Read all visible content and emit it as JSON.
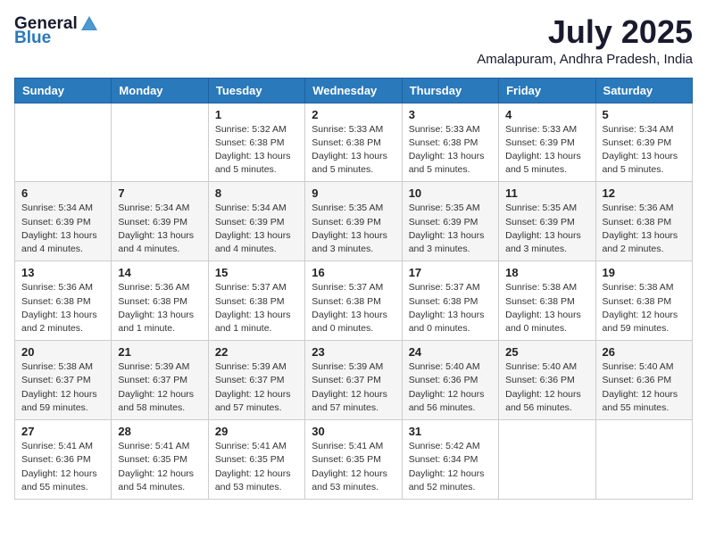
{
  "header": {
    "logo_general": "General",
    "logo_blue": "Blue",
    "month": "July 2025",
    "location": "Amalapuram, Andhra Pradesh, India"
  },
  "days_of_week": [
    "Sunday",
    "Monday",
    "Tuesday",
    "Wednesday",
    "Thursday",
    "Friday",
    "Saturday"
  ],
  "weeks": [
    [
      {
        "day": "",
        "info": ""
      },
      {
        "day": "",
        "info": ""
      },
      {
        "day": "1",
        "info": "Sunrise: 5:32 AM\nSunset: 6:38 PM\nDaylight: 13 hours and 5 minutes."
      },
      {
        "day": "2",
        "info": "Sunrise: 5:33 AM\nSunset: 6:38 PM\nDaylight: 13 hours and 5 minutes."
      },
      {
        "day": "3",
        "info": "Sunrise: 5:33 AM\nSunset: 6:38 PM\nDaylight: 13 hours and 5 minutes."
      },
      {
        "day": "4",
        "info": "Sunrise: 5:33 AM\nSunset: 6:39 PM\nDaylight: 13 hours and 5 minutes."
      },
      {
        "day": "5",
        "info": "Sunrise: 5:34 AM\nSunset: 6:39 PM\nDaylight: 13 hours and 5 minutes."
      }
    ],
    [
      {
        "day": "6",
        "info": "Sunrise: 5:34 AM\nSunset: 6:39 PM\nDaylight: 13 hours and 4 minutes."
      },
      {
        "day": "7",
        "info": "Sunrise: 5:34 AM\nSunset: 6:39 PM\nDaylight: 13 hours and 4 minutes."
      },
      {
        "day": "8",
        "info": "Sunrise: 5:34 AM\nSunset: 6:39 PM\nDaylight: 13 hours and 4 minutes."
      },
      {
        "day": "9",
        "info": "Sunrise: 5:35 AM\nSunset: 6:39 PM\nDaylight: 13 hours and 3 minutes."
      },
      {
        "day": "10",
        "info": "Sunrise: 5:35 AM\nSunset: 6:39 PM\nDaylight: 13 hours and 3 minutes."
      },
      {
        "day": "11",
        "info": "Sunrise: 5:35 AM\nSunset: 6:39 PM\nDaylight: 13 hours and 3 minutes."
      },
      {
        "day": "12",
        "info": "Sunrise: 5:36 AM\nSunset: 6:38 PM\nDaylight: 13 hours and 2 minutes."
      }
    ],
    [
      {
        "day": "13",
        "info": "Sunrise: 5:36 AM\nSunset: 6:38 PM\nDaylight: 13 hours and 2 minutes."
      },
      {
        "day": "14",
        "info": "Sunrise: 5:36 AM\nSunset: 6:38 PM\nDaylight: 13 hours and 1 minute."
      },
      {
        "day": "15",
        "info": "Sunrise: 5:37 AM\nSunset: 6:38 PM\nDaylight: 13 hours and 1 minute."
      },
      {
        "day": "16",
        "info": "Sunrise: 5:37 AM\nSunset: 6:38 PM\nDaylight: 13 hours and 0 minutes."
      },
      {
        "day": "17",
        "info": "Sunrise: 5:37 AM\nSunset: 6:38 PM\nDaylight: 13 hours and 0 minutes."
      },
      {
        "day": "18",
        "info": "Sunrise: 5:38 AM\nSunset: 6:38 PM\nDaylight: 13 hours and 0 minutes."
      },
      {
        "day": "19",
        "info": "Sunrise: 5:38 AM\nSunset: 6:38 PM\nDaylight: 12 hours and 59 minutes."
      }
    ],
    [
      {
        "day": "20",
        "info": "Sunrise: 5:38 AM\nSunset: 6:37 PM\nDaylight: 12 hours and 59 minutes."
      },
      {
        "day": "21",
        "info": "Sunrise: 5:39 AM\nSunset: 6:37 PM\nDaylight: 12 hours and 58 minutes."
      },
      {
        "day": "22",
        "info": "Sunrise: 5:39 AM\nSunset: 6:37 PM\nDaylight: 12 hours and 57 minutes."
      },
      {
        "day": "23",
        "info": "Sunrise: 5:39 AM\nSunset: 6:37 PM\nDaylight: 12 hours and 57 minutes."
      },
      {
        "day": "24",
        "info": "Sunrise: 5:40 AM\nSunset: 6:36 PM\nDaylight: 12 hours and 56 minutes."
      },
      {
        "day": "25",
        "info": "Sunrise: 5:40 AM\nSunset: 6:36 PM\nDaylight: 12 hours and 56 minutes."
      },
      {
        "day": "26",
        "info": "Sunrise: 5:40 AM\nSunset: 6:36 PM\nDaylight: 12 hours and 55 minutes."
      }
    ],
    [
      {
        "day": "27",
        "info": "Sunrise: 5:41 AM\nSunset: 6:36 PM\nDaylight: 12 hours and 55 minutes."
      },
      {
        "day": "28",
        "info": "Sunrise: 5:41 AM\nSunset: 6:35 PM\nDaylight: 12 hours and 54 minutes."
      },
      {
        "day": "29",
        "info": "Sunrise: 5:41 AM\nSunset: 6:35 PM\nDaylight: 12 hours and 53 minutes."
      },
      {
        "day": "30",
        "info": "Sunrise: 5:41 AM\nSunset: 6:35 PM\nDaylight: 12 hours and 53 minutes."
      },
      {
        "day": "31",
        "info": "Sunrise: 5:42 AM\nSunset: 6:34 PM\nDaylight: 12 hours and 52 minutes."
      },
      {
        "day": "",
        "info": ""
      },
      {
        "day": "",
        "info": ""
      }
    ]
  ]
}
